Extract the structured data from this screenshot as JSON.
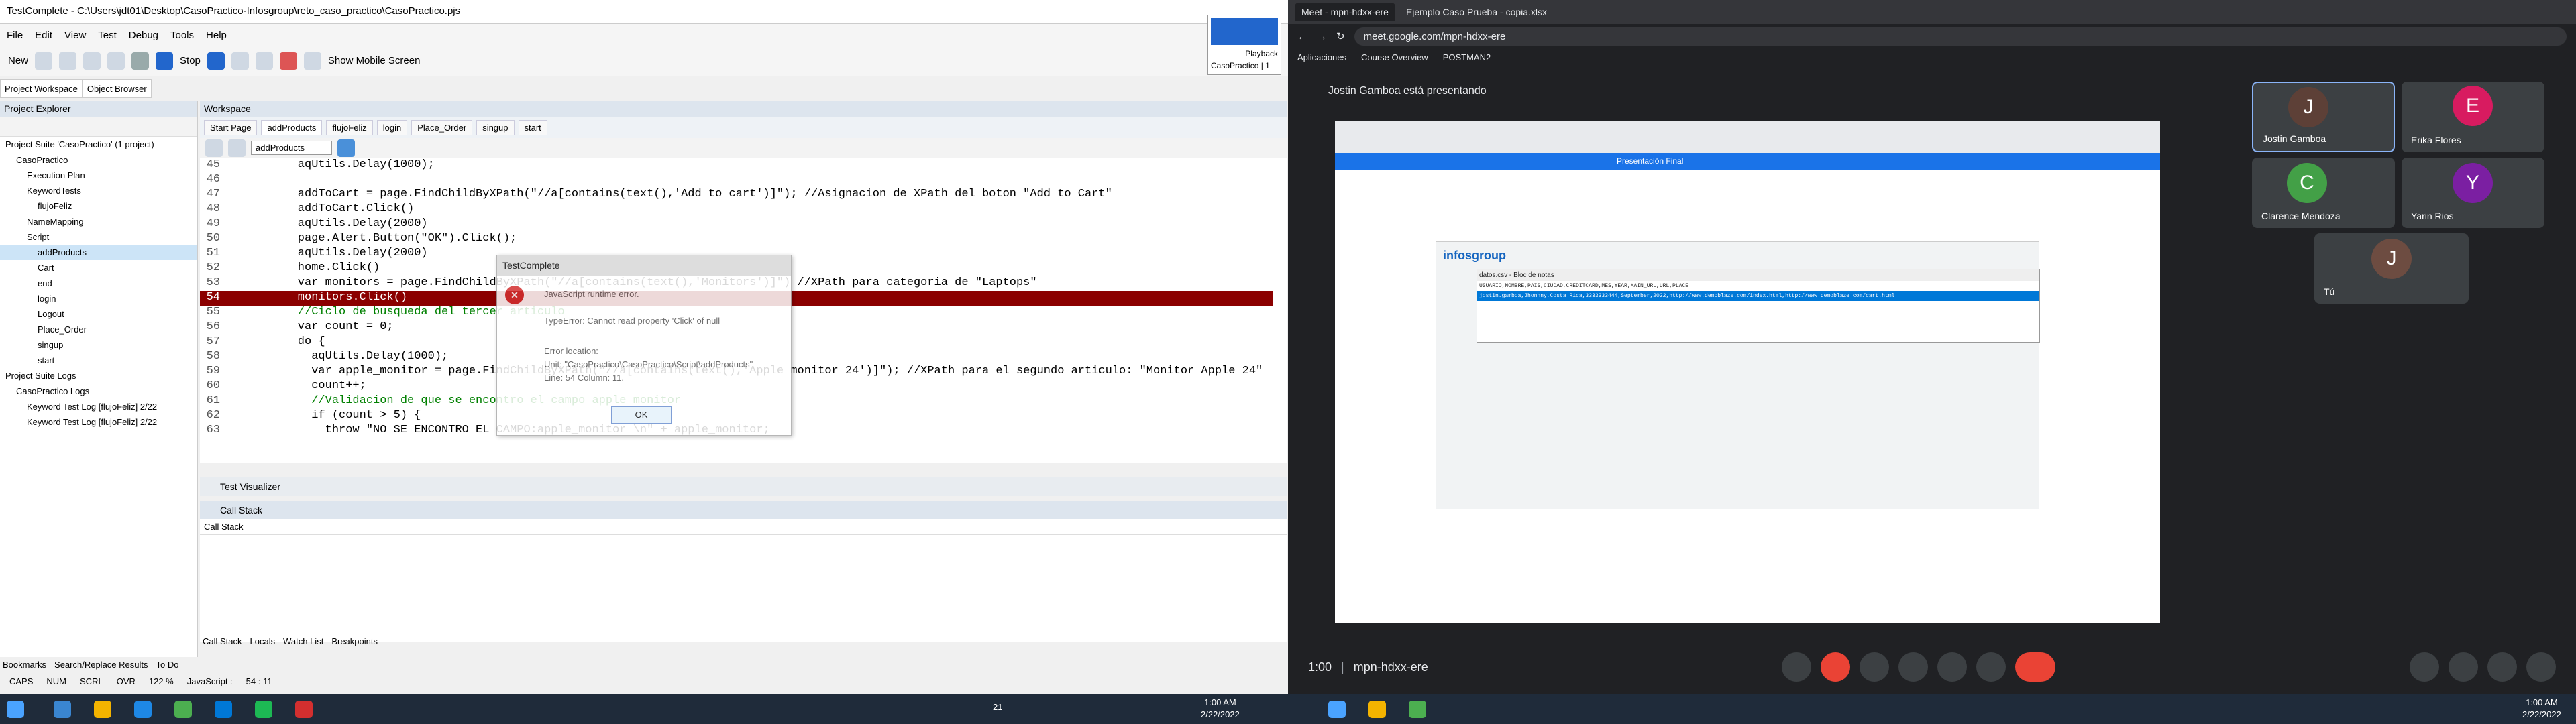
{
  "testcomplete": {
    "title": "TestComplete - C:\\Users\\jdt01\\Desktop\\CasoPractico-Infosgroup\\reto_caso_practico\\CasoPractico.pjs",
    "menu": [
      "File",
      "Edit",
      "View",
      "Test",
      "Debug",
      "Tools",
      "Help"
    ],
    "toolbar": {
      "new": "New",
      "stop": "Stop",
      "mobile": "Show Mobile Screen"
    },
    "workspace_tabs": [
      "Project Workspace",
      "Object Browser"
    ],
    "project_explorer": {
      "title": "Project Explorer",
      "tree": [
        {
          "label": "Project Suite 'CasoPractico' (1 project)",
          "indent": 0
        },
        {
          "label": "CasoPractico",
          "indent": 1
        },
        {
          "label": "Execution Plan",
          "indent": 2
        },
        {
          "label": "KeywordTests",
          "indent": 2
        },
        {
          "label": "flujoFeliz",
          "indent": 3
        },
        {
          "label": "NameMapping",
          "indent": 2
        },
        {
          "label": "Script",
          "indent": 2
        },
        {
          "label": "addProducts",
          "indent": 3
        },
        {
          "label": "Cart",
          "indent": 3
        },
        {
          "label": "end",
          "indent": 3
        },
        {
          "label": "login",
          "indent": 3
        },
        {
          "label": "Logout",
          "indent": 3
        },
        {
          "label": "Place_Order",
          "indent": 3
        },
        {
          "label": "singup",
          "indent": 3
        },
        {
          "label": "start",
          "indent": 3
        },
        {
          "label": "Project Suite Logs",
          "indent": 0
        },
        {
          "label": "CasoPractico Logs",
          "indent": 1
        },
        {
          "label": "Keyword Test Log [flujoFeliz] 2/22",
          "indent": 2
        },
        {
          "label": "Keyword Test Log [flujoFeliz] 2/22",
          "indent": 2
        }
      ]
    },
    "workspace": {
      "title": "Workspace",
      "tabs": [
        "Start Page",
        "addProducts",
        "flujoFeliz",
        "login",
        "Place_Order",
        "singup",
        "start"
      ],
      "routine": "addProducts"
    },
    "code": [
      {
        "n": "45",
        "t": "    aqUtils.Delay(1000);"
      },
      {
        "n": "46",
        "t": ""
      },
      {
        "n": "47",
        "t": "    addToCart = page.FindChildByXPath(\"//a[contains(text(),'Add to cart')]\"); //Asignacion de XPath del boton \"Add to Cart\""
      },
      {
        "n": "48",
        "t": "    addToCart.Click()"
      },
      {
        "n": "49",
        "t": "    aqUtils.Delay(2000)"
      },
      {
        "n": "50",
        "t": "    page.Alert.Button(\"OK\").Click();"
      },
      {
        "n": "51",
        "t": "    aqUtils.Delay(2000)"
      },
      {
        "n": "52",
        "t": "    home.Click()"
      },
      {
        "n": "53",
        "t": "    var monitors = page.FindChildByXPath(\"//a[contains(text(),'Monitors')]\") //XPath para categoria de \"Laptops\""
      },
      {
        "n": "54",
        "t": "    monitors.Click()"
      },
      {
        "n": "55",
        "t": "    //Ciclo de busqueda del tercer articulo"
      },
      {
        "n": "56",
        "t": "    var count = 0;"
      },
      {
        "n": "57",
        "t": "    do {"
      },
      {
        "n": "58",
        "t": "      aqUtils.Delay(1000);"
      },
      {
        "n": "59",
        "t": "      var apple_monitor = page.FindChildByXPath(\"//a[contains(text(),'Apple monitor 24')]\"); //XPath para el segundo articulo: \"Monitor Apple 24\""
      },
      {
        "n": "60",
        "t": "      count++;"
      },
      {
        "n": "61",
        "t": "      //Validacion de que se encontro el campo apple_monitor"
      },
      {
        "n": "62",
        "t": "      if (count > 5) {"
      },
      {
        "n": "63",
        "t": "        throw \"NO SE ENCONTRO EL CAMPO:apple_monitor \\n\" + apple_monitor;"
      }
    ],
    "dialog": {
      "title": "TestComplete",
      "header": "JavaScript runtime error.",
      "error": "TypeError: Cannot read property 'Click' of null",
      "loc_label": "Error location:",
      "unit": "Unit: \"CasoPractico\\CasoPractico\\Script\\addProducts\"",
      "line": "Line: 54 Column: 11.",
      "ok": "OK"
    },
    "test_visualizer": "Test Visualizer",
    "call_stack": {
      "title": "Call Stack",
      "header": "Call Stack"
    },
    "bottom_tabs": [
      "Call Stack",
      "Locals",
      "Watch List",
      "Breakpoints"
    ],
    "left_bottom_tabs": [
      "Bookmarks",
      "Search/Replace Results",
      "To Do"
    ],
    "status": [
      "CAPS",
      "NUM",
      "SCRL",
      "OVR",
      "122 %",
      "JavaScript :",
      "54 : 11"
    ],
    "playback": {
      "label": "Playback",
      "sub": "CasoPractico | 1"
    }
  },
  "browser": {
    "tabs": [
      "Meet - mpn-hdxx-ere",
      "Ejemplo Caso Prueba - copia.xlsx"
    ],
    "url": "meet.google.com/mpn-hdxx-ere",
    "bookmarks": [
      "Aplicaciones",
      "Course Overview",
      "POSTMAN2"
    ],
    "presenting": "Jostin Gamboa está presentando",
    "shared": {
      "app": "Presentación Final",
      "logo": "infosgroup",
      "file": "datos.csv - Bloc de notas",
      "csv_header": "USUARIO,NOMBRE,PAIS,CIUDAD,CREDITCARD,MES,YEAR,MAIN_URL,URL,PLACE",
      "csv_row": "jostin.gamboa,Jhonnny,Costa Rica,3333333444,September,2022,http://www.demoblaze.com/index.html,http://www.demoblaze.com/cart.html"
    },
    "participants": [
      {
        "name": "Jostin Gamboa",
        "initial": "J",
        "color": "#5d4037"
      },
      {
        "name": "Erika Flores",
        "initial": "E",
        "color": "#d81b60"
      },
      {
        "name": "Clarence Mendoza",
        "initial": "C",
        "color": "#43a047"
      },
      {
        "name": "Yarin Rios",
        "initial": "Y",
        "color": "#7b1fa2"
      },
      {
        "name": "Tú",
        "initial": "J",
        "color": "#6d4c41"
      }
    ],
    "meeting": {
      "time": "1:00",
      "code": "mpn-hdxx-ere"
    }
  },
  "taskbar": {
    "time": "1:00 AM",
    "date": "2/22/2022",
    "time2": "1:00 AM",
    "date2": "2/22/2022",
    "num": "21"
  }
}
